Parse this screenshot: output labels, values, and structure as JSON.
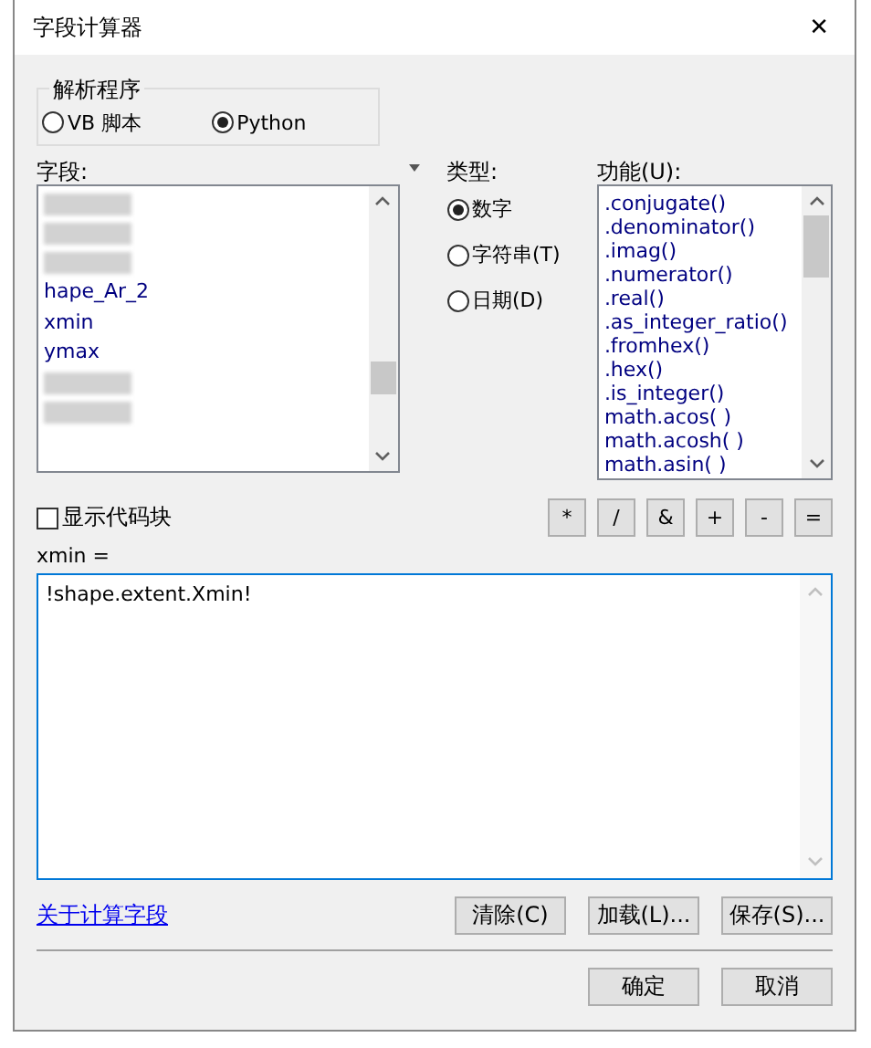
{
  "window": {
    "title": "字段计算器",
    "close": "✕"
  },
  "parser": {
    "label": "解析程序",
    "options": [
      {
        "label": "VB 脚本",
        "selected": false
      },
      {
        "label": "Python",
        "selected": true
      }
    ]
  },
  "fields": {
    "label": "字段:",
    "items": [
      {
        "kind": "blurred"
      },
      {
        "kind": "blurred"
      },
      {
        "kind": "blurred"
      },
      {
        "kind": "text",
        "label": "hape_Ar_2"
      },
      {
        "kind": "text",
        "label": "xmin"
      },
      {
        "kind": "text",
        "label": "ymax"
      },
      {
        "kind": "blurred"
      },
      {
        "kind": "blurred"
      }
    ]
  },
  "type": {
    "label": "类型:",
    "options": [
      {
        "label": "数字",
        "selected": true
      },
      {
        "label": "字符串(T)",
        "selected": false
      },
      {
        "label": "日期(D)",
        "selected": false
      }
    ]
  },
  "functions": {
    "label": "功能(U):",
    "items": [
      ".conjugate()",
      ".denominator()",
      ".imag()",
      ".numerator()",
      ".real()",
      ".as_integer_ratio()",
      ".fromhex()",
      ".hex()",
      ".is_integer()",
      "math.acos( )",
      "math.acosh( )",
      "math.asin( )"
    ]
  },
  "show_codeblock": {
    "label": "显示代码块",
    "checked": false
  },
  "operators": [
    "*",
    "/",
    "&",
    "+",
    "-",
    "="
  ],
  "expression": {
    "label": "xmin =",
    "value": "!shape.extent.Xmin!"
  },
  "help_link": "关于计算字段",
  "file_buttons": [
    "清除(C)",
    "加载(L)...",
    "保存(S)..."
  ],
  "dialog_buttons": [
    "确定",
    "取消"
  ]
}
